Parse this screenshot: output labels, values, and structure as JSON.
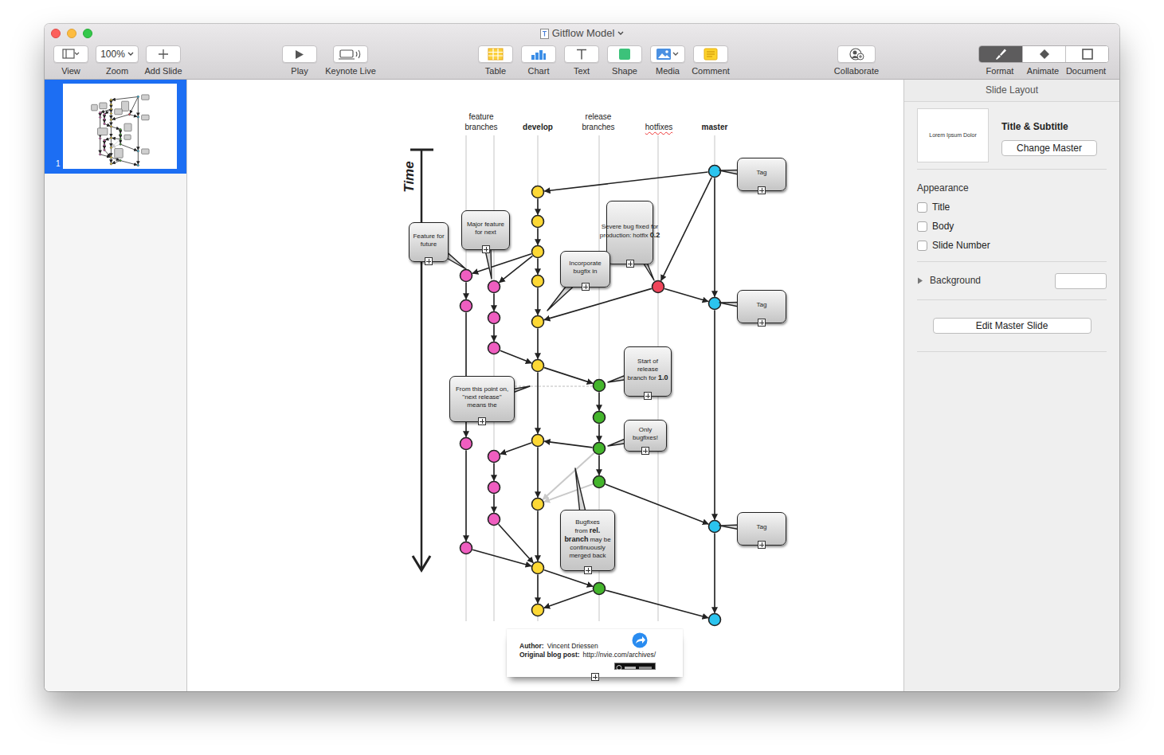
{
  "window": {
    "title": "Gitflow Model"
  },
  "toolbar": {
    "items": [
      {
        "kind": "view",
        "label": "View"
      },
      {
        "kind": "zoom",
        "label": "Zoom",
        "value": "100%"
      },
      {
        "kind": "add",
        "label": "Add Slide"
      },
      {
        "kind": "play",
        "label": "Play"
      },
      {
        "kind": "live",
        "label": "Keynote Live"
      },
      {
        "kind": "table",
        "label": "Table"
      },
      {
        "kind": "chart",
        "label": "Chart"
      },
      {
        "kind": "text",
        "label": "Text"
      },
      {
        "kind": "shape",
        "label": "Shape"
      },
      {
        "kind": "media",
        "label": "Media"
      },
      {
        "kind": "comment",
        "label": "Comment"
      },
      {
        "kind": "collaborate",
        "label": "Collaborate"
      }
    ],
    "inspector_tabs": [
      {
        "kind": "format",
        "label": "Format",
        "selected": true
      },
      {
        "kind": "animate",
        "label": "Animate",
        "selected": false
      },
      {
        "kind": "document",
        "label": "Document",
        "selected": false
      }
    ]
  },
  "slides": [
    {
      "number": "1",
      "selected": true
    }
  ],
  "diagram": {
    "time_label": "Time",
    "headers": [
      {
        "label": "feature branches",
        "bold": false,
        "misspelled": false
      },
      {
        "label": "develop",
        "bold": true,
        "misspelled": false
      },
      {
        "label": "release branches",
        "bold": false,
        "misspelled": false
      },
      {
        "label": "hotfixes",
        "bold": false,
        "misspelled": true
      },
      {
        "label": "master",
        "bold": true,
        "misspelled": false
      }
    ],
    "nodes": [
      {
        "branch": "master",
        "color": "#2bc4ef"
      },
      {
        "branch": "master",
        "color": "#2bc4ef"
      },
      {
        "branch": "master",
        "color": "#2bc4ef"
      },
      {
        "branch": "master",
        "color": "#2bc4ef"
      },
      {
        "branch": "hotfix",
        "color": "#f0455a"
      },
      {
        "branch": "release",
        "color": "#44b52c"
      },
      {
        "branch": "release",
        "color": "#44b52c"
      },
      {
        "branch": "release",
        "color": "#44b52c"
      },
      {
        "branch": "release",
        "color": "#44b52c"
      },
      {
        "branch": "release",
        "color": "#44b52c"
      },
      {
        "branch": "develop",
        "color": "#fdd835"
      },
      {
        "branch": "develop",
        "color": "#fdd835"
      },
      {
        "branch": "develop",
        "color": "#fdd835"
      },
      {
        "branch": "develop",
        "color": "#fdd835"
      },
      {
        "branch": "develop",
        "color": "#fdd835"
      },
      {
        "branch": "develop",
        "color": "#fdd835"
      },
      {
        "branch": "develop",
        "color": "#fdd835"
      },
      {
        "branch": "develop",
        "color": "#fdd835"
      },
      {
        "branch": "develop",
        "color": "#fdd835"
      },
      {
        "branch": "develop",
        "color": "#fdd835"
      },
      {
        "branch": "feature-1",
        "color": "#ef5ec0"
      },
      {
        "branch": "feature-1",
        "color": "#ef5ec0"
      },
      {
        "branch": "feature-1",
        "color": "#ef5ec0"
      },
      {
        "branch": "feature-1",
        "color": "#ef5ec0"
      },
      {
        "branch": "feature-2",
        "color": "#ef5ec0"
      },
      {
        "branch": "feature-2",
        "color": "#ef5ec0"
      },
      {
        "branch": "feature-2",
        "color": "#ef5ec0"
      },
      {
        "branch": "feature-2",
        "color": "#ef5ec0"
      },
      {
        "branch": "feature-2",
        "color": "#ef5ec0"
      },
      {
        "branch": "feature-2",
        "color": "#ef5ec0"
      }
    ],
    "edges": [
      {
        "from": 0,
        "to": 1,
        "kind": "solid"
      },
      {
        "from": 1,
        "to": 2,
        "kind": "solid"
      },
      {
        "from": 2,
        "to": 3,
        "kind": "solid"
      },
      {
        "from": 0,
        "to": 10,
        "kind": "solid"
      },
      {
        "from": 0,
        "to": 4,
        "kind": "solid"
      },
      {
        "from": 4,
        "to": 1,
        "kind": "solid"
      },
      {
        "from": 4,
        "to": 14,
        "kind": "solid"
      },
      {
        "from": 10,
        "to": 11,
        "kind": "solid"
      },
      {
        "from": 11,
        "to": 12,
        "kind": "solid"
      },
      {
        "from": 12,
        "to": 13,
        "kind": "solid"
      },
      {
        "from": 13,
        "to": 14,
        "kind": "solid"
      },
      {
        "from": 14,
        "to": 15,
        "kind": "solid"
      },
      {
        "from": 15,
        "to": 16,
        "kind": "solid"
      },
      {
        "from": 16,
        "to": 17,
        "kind": "solid"
      },
      {
        "from": 17,
        "to": 18,
        "kind": "solid"
      },
      {
        "from": 18,
        "to": 19,
        "kind": "solid"
      },
      {
        "from": 12,
        "to": 20,
        "kind": "solid"
      },
      {
        "from": 12,
        "to": 24,
        "kind": "solid"
      },
      {
        "from": 20,
        "to": 21,
        "kind": "solid"
      },
      {
        "from": 21,
        "to": 22,
        "kind": "solid"
      },
      {
        "from": 22,
        "to": 23,
        "kind": "solid"
      },
      {
        "from": 23,
        "to": 18,
        "kind": "solid"
      },
      {
        "from": 24,
        "to": 25,
        "kind": "solid"
      },
      {
        "from": 25,
        "to": 26,
        "kind": "solid"
      },
      {
        "from": 26,
        "to": 15,
        "kind": "solid"
      },
      {
        "from": 16,
        "to": 27,
        "kind": "solid"
      },
      {
        "from": 27,
        "to": 28,
        "kind": "solid"
      },
      {
        "from": 28,
        "to": 29,
        "kind": "solid"
      },
      {
        "from": 29,
        "to": 18,
        "kind": "solid"
      },
      {
        "from": 15,
        "to": 5,
        "kind": "solid"
      },
      {
        "from": 5,
        "to": 6,
        "kind": "solid"
      },
      {
        "from": 6,
        "to": 7,
        "kind": "solid"
      },
      {
        "from": 7,
        "to": 8,
        "kind": "solid"
      },
      {
        "from": 7,
        "to": 16,
        "kind": "solid"
      },
      {
        "from": 8,
        "to": 2,
        "kind": "solid"
      },
      {
        "from": 7,
        "to": 17,
        "kind": "faded"
      },
      {
        "from": 8,
        "to": 17,
        "kind": "faded"
      },
      {
        "from": 18,
        "to": 9,
        "kind": "solid"
      },
      {
        "from": 9,
        "to": 19,
        "kind": "solid"
      },
      {
        "from": 9,
        "to": 3,
        "kind": "solid"
      }
    ],
    "callouts": [
      {
        "segments": [
          {
            "text": "Feature for future",
            "bold": false
          }
        ]
      },
      {
        "segments": [
          {
            "text": "Major feature for next",
            "bold": false
          }
        ]
      },
      {
        "segments": [
          {
            "text": "Severe bug fixed for production:",
            "bold": false
          },
          {
            "text": "hotfix",
            "bold": false
          },
          {
            "text": "0.2",
            "bold": true
          }
        ]
      },
      {
        "segments": [
          {
            "text": "Incorporate bugfix in",
            "bold": false
          }
        ]
      },
      {
        "segments": [
          {
            "text": "Start of release branch for",
            "bold": false
          },
          {
            "text": "1.0",
            "bold": true
          }
        ]
      },
      {
        "segments": [
          {
            "text": "From this point on, \"next release\" means the",
            "bold": false
          }
        ]
      },
      {
        "segments": [
          {
            "text": "Only bugfixes!",
            "bold": false
          }
        ]
      },
      {
        "segments": [
          {
            "text": "Bugfixes from",
            "bold": false
          },
          {
            "text": "rel. branch",
            "bold": true
          },
          {
            "text": "may be continuously merged back",
            "bold": false
          }
        ]
      },
      {
        "segments": [
          {
            "text": "Tag",
            "bold": false
          }
        ]
      },
      {
        "segments": [
          {
            "text": "Tag",
            "bold": false
          }
        ]
      },
      {
        "segments": [
          {
            "text": "Tag",
            "bold": false
          }
        ]
      }
    ],
    "footer": {
      "author_label": "Author:",
      "author": "Vincent Driessen",
      "post_label": "Original blog post:",
      "link": "http://nvie.com/archives/"
    }
  },
  "inspector": {
    "header": "Slide Layout",
    "layout_preview": "Lorem Ipsum Dolor",
    "layout_name": "Title & Subtitle",
    "change_master": "Change Master",
    "appearance_label": "Appearance",
    "options": [
      {
        "label": "Title",
        "checked": false
      },
      {
        "label": "Body",
        "checked": false
      },
      {
        "label": "Slide Number",
        "checked": false
      }
    ],
    "background": {
      "label": "Background",
      "expanded": false
    },
    "edit_master": "Edit Master Slide"
  }
}
